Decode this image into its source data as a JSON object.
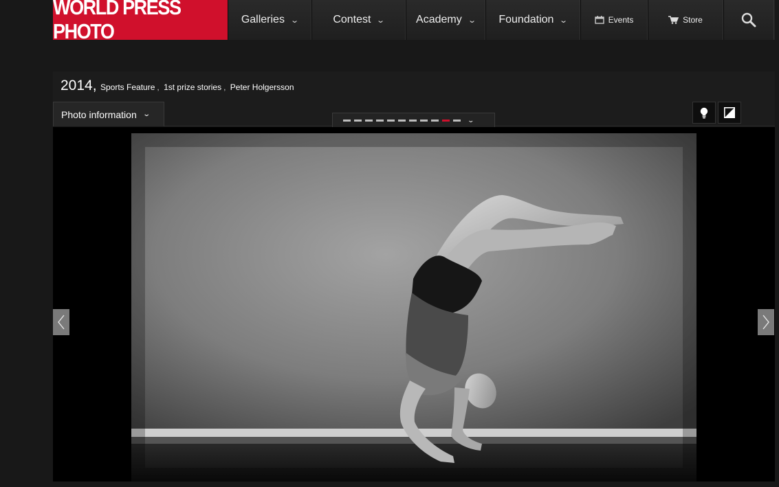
{
  "nav": {
    "logo": "WORLD PRESS PHOTO",
    "items": [
      {
        "label": "Galleries"
      },
      {
        "label": "Contest"
      },
      {
        "label": "Academy"
      },
      {
        "label": "Foundation"
      }
    ],
    "events_label": "Events",
    "store_label": "Store",
    "icons": {
      "events": "calendar-icon",
      "store": "cart-icon",
      "search": "search-icon"
    }
  },
  "title": {
    "year": "2014,",
    "category": "Sports Feature",
    "sep1": ",",
    "award": "1st prize stories",
    "sep2": ",",
    "photographer": "Peter Holgersson"
  },
  "controls": {
    "photo_info_label": "Photo information",
    "pager": {
      "total": 11,
      "active_index": 9
    },
    "tools": [
      "lightbulb-icon",
      "contrast-icon"
    ]
  },
  "stage": {
    "prev_icon": "chevron-left-icon",
    "next_icon": "chevron-right-icon",
    "photo": "black-and-white photo of a gymnast in a handstand"
  },
  "colors": {
    "brand_red": "#d0102c",
    "nav_bg": "#222222",
    "page_bg": "#181818",
    "stage_bg": "#000000"
  }
}
